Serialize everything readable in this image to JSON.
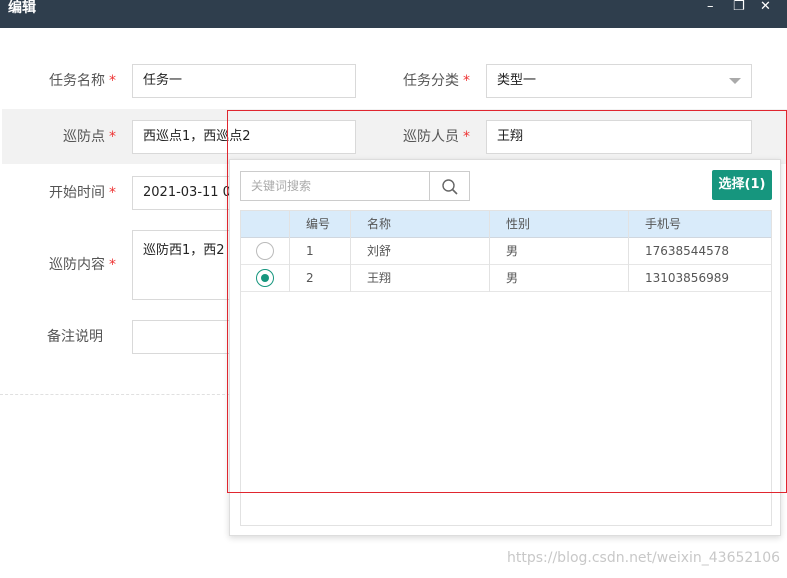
{
  "window": {
    "title": "编辑",
    "minimize_label": "–",
    "maximize_label": "❐",
    "close_label": "✕"
  },
  "form": {
    "task_name": {
      "label": "任务名称",
      "required_mark": "*",
      "value": "任务一"
    },
    "task_category": {
      "label": "任务分类",
      "required_mark": "*",
      "value": "类型一"
    },
    "patrol_points": {
      "label": "巡防点",
      "required_mark": "*",
      "value": "西巡点1，西巡点2"
    },
    "patrol_staff": {
      "label": "巡防人员",
      "required_mark": "*",
      "value": "王翔"
    },
    "start_time": {
      "label": "开始时间",
      "required_mark": "*",
      "value": "2021-03-11 0"
    },
    "patrol_content": {
      "label": "巡防内容",
      "required_mark": "*",
      "value": "巡防西1，西2"
    },
    "remarks": {
      "label": "备注说明",
      "value": ""
    }
  },
  "picker": {
    "search_placeholder": "关键词搜索",
    "select_button": "选择(1)",
    "columns": [
      "编号",
      "名称",
      "性别",
      "手机号"
    ],
    "rows": [
      {
        "id": "1",
        "name": "刘舒",
        "gender": "男",
        "phone": "17638544578",
        "selected": false
      },
      {
        "id": "2",
        "name": "王翔",
        "gender": "男",
        "phone": "13103856989",
        "selected": true
      }
    ]
  },
  "watermark": "https://blog.csdn.net/weixin_43652106",
  "colors": {
    "titlebar": "#2f3e4d",
    "accent": "#16967e",
    "required": "#e33333",
    "annotation_box": "#e0262f",
    "table_header": "#d9ebfa"
  }
}
